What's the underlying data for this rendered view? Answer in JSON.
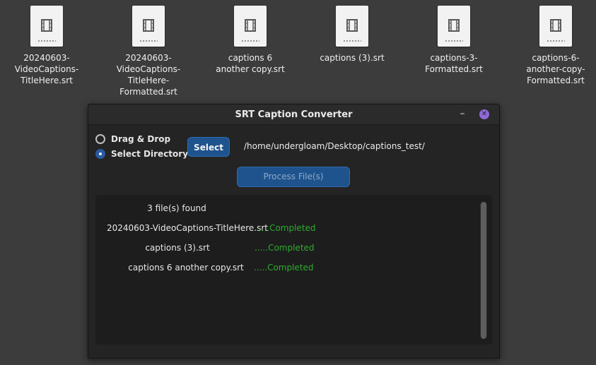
{
  "desktop": {
    "files": [
      {
        "label": "20240603-\nVideoCaptions-\nTitleHere.srt",
        "icon": "video-file-icon"
      },
      {
        "label": "20240603-\nVideoCaptions-\nTitleHere-\nFormatted.srt",
        "icon": "video-file-icon"
      },
      {
        "label": "captions 6\nanother copy.srt",
        "icon": "video-file-icon"
      },
      {
        "label": "captions (3).srt",
        "icon": "video-file-icon"
      },
      {
        "label": "captions-3-\nFormatted.srt",
        "icon": "video-file-icon"
      },
      {
        "label": "captions-6-\nanother-copy-\nFormatted.srt",
        "icon": "video-file-icon"
      }
    ]
  },
  "window": {
    "title": "SRT Caption Converter",
    "minimize_label": "–",
    "close_label": "✕"
  },
  "mode": {
    "options": [
      {
        "label": "Drag & Drop",
        "selected": false
      },
      {
        "label": "Select Directory",
        "selected": true
      }
    ]
  },
  "controls": {
    "select_label": "Select",
    "path": "/home/undergloam/Desktop/captions_test/",
    "process_label": "Process File(s)"
  },
  "log": {
    "found": "3 file(s) found",
    "entries": [
      {
        "file": "20240603-VideoCaptions-TitleHere.srt",
        "status": ".....Completed"
      },
      {
        "file": "captions (3).srt",
        "status": ".....Completed"
      },
      {
        "file": "captions 6 another copy.srt",
        "status": ".....Completed"
      }
    ]
  },
  "colors": {
    "accent": "#1f538d",
    "success": "#2eab2e",
    "close_button": "#8e6ad6"
  }
}
